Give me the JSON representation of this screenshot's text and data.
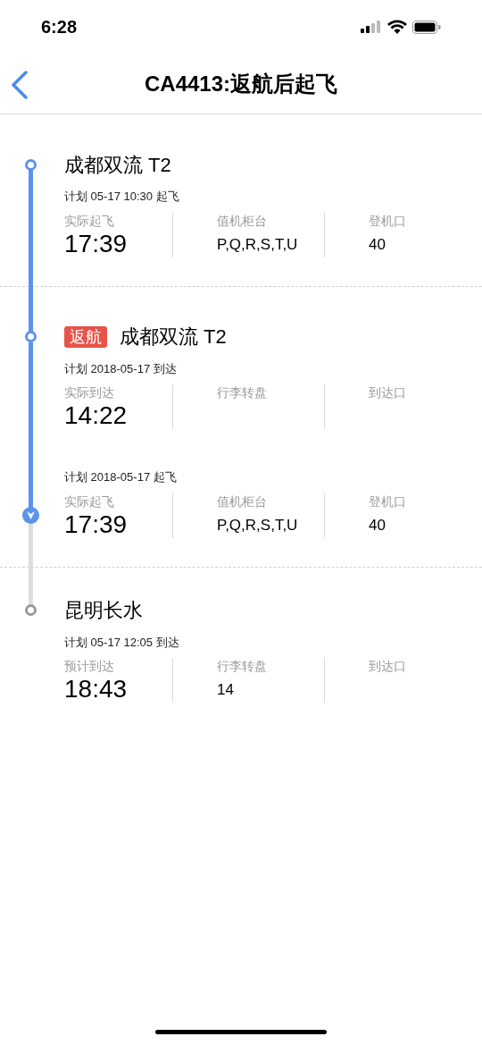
{
  "status_bar": {
    "time": "6:28"
  },
  "header": {
    "title": "CA4413:返航后起飞"
  },
  "stops": [
    {
      "title": "成都双流 T2",
      "reached": true,
      "legs": [
        {
          "plan": "计划 05-17 10:30 起飞",
          "current": false,
          "cells": [
            {
              "label": "实际起飞",
              "value": "17:39"
            },
            {
              "label": "值机柜台",
              "value": "P,Q,R,S,T,U"
            },
            {
              "label": "登机口",
              "value": "40"
            }
          ]
        }
      ]
    },
    {
      "badge": "返航",
      "title": "成都双流 T2",
      "reached": true,
      "legs": [
        {
          "plan": "计划 2018-05-17 到达",
          "current": false,
          "cells": [
            {
              "label": "实际到达",
              "value": "14:22"
            },
            {
              "label": "行李转盘"
            },
            {
              "label": "到达口"
            }
          ]
        },
        {
          "plan": "计划 2018-05-17 起飞",
          "current": true,
          "cells": [
            {
              "label": "实际起飞",
              "value": "17:39"
            },
            {
              "label": "值机柜台",
              "value": "P,Q,R,S,T,U"
            },
            {
              "label": "登机口",
              "value": "40"
            }
          ]
        }
      ]
    },
    {
      "title": "昆明长水",
      "reached": false,
      "legs": [
        {
          "plan": "计划 05-17 12:05 到达",
          "current": false,
          "cells": [
            {
              "label": "预计到达",
              "value": "18:43"
            },
            {
              "label": "行李转盘",
              "value": "14"
            },
            {
              "label": "到达口"
            }
          ]
        }
      ]
    }
  ]
}
